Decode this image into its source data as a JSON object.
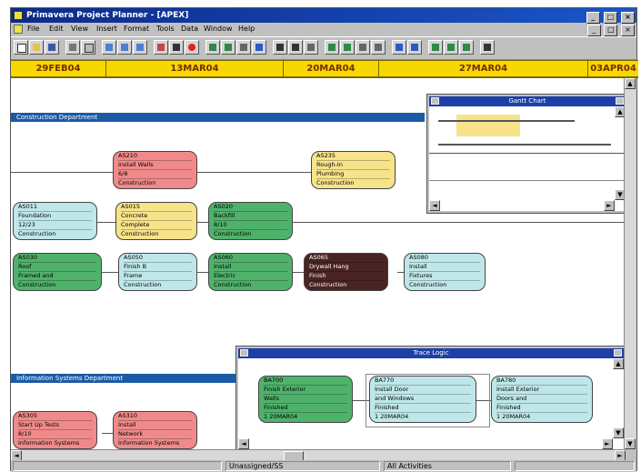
{
  "window": {
    "title": "Primavera Project Planner - [APEX]",
    "controls": [
      "_",
      "□",
      "×"
    ]
  },
  "menu": {
    "items": [
      "File",
      "Edit",
      "View",
      "Insert",
      "Format",
      "Tools",
      "Data",
      "Window",
      "Help"
    ]
  },
  "colors": {
    "title": "#1a3c9e",
    "timescale": "#f6d800",
    "band": "#1c5aa6",
    "red": "#f08a8a",
    "yellow": "#f7e38a",
    "green": "#4fb26b",
    "cyan": "#bfe7ea",
    "dark": "#4a2323"
  },
  "timescale": [
    "29FEB04",
    "13MAR04",
    "20MAR04",
    "27MAR04",
    "03APR04"
  ],
  "bands": {
    "construction": "Construction Department",
    "information": "Information Systems Department"
  },
  "nodes": {
    "n1": [
      "AS210",
      "Install Walls",
      "6/8",
      "Construction"
    ],
    "n2": [
      "AS235",
      "Rough-In",
      "Plumbing",
      "Construction"
    ],
    "n3": [
      "AS011",
      "Foundation",
      "12/23",
      "Construction"
    ],
    "n4": [
      "AS015",
      "Concrete",
      "Complete",
      "Construction"
    ],
    "n5": [
      "AS020",
      "Backfill",
      "8/10",
      "Construction"
    ],
    "n6": [
      "AS030",
      "Roof",
      "Framed and",
      "Construction"
    ],
    "n7": [
      "AS050",
      "Finish B",
      "Frame",
      "Construction"
    ],
    "n8": [
      "AS060",
      "Install",
      "Electric",
      "Construction"
    ],
    "n9": [
      "AS065",
      "Drywall Hang",
      "Finish",
      "Construction"
    ],
    "n10": [
      "AS080",
      "Install",
      "Fixtures",
      "Construction"
    ],
    "n11": [
      "AS305",
      "Start Up Tests",
      "8/10",
      "Information Systems"
    ],
    "n12": [
      "AS310",
      "Install",
      "Network",
      "Information Systems"
    ]
  },
  "trace": {
    "title": "Trace Logic",
    "nodes": [
      [
        "BA700",
        "Finish Exterior",
        "Walls",
        "Finished",
        "1 20MAR04"
      ],
      [
        "BA770",
        "Install Door",
        "and Windows",
        "Finished",
        "1 20MAR04"
      ],
      [
        "BA780",
        "Install Exterior",
        "Doors and",
        "Finished",
        "1 20MAR04"
      ]
    ]
  },
  "gantt": {
    "title": "Gantt Chart"
  },
  "status": {
    "panel1": "",
    "panel2": "Unassigned/SS",
    "panel3": "All Activities"
  }
}
